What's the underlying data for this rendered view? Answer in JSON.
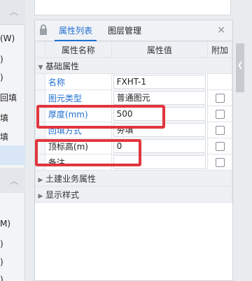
{
  "left_panel": {
    "items": [
      "(W)",
      ")",
      ")",
      "回填",
      "填",
      "填",
      "M)",
      ")",
      ")",
      ")"
    ]
  },
  "panel": {
    "tabs": [
      {
        "label": "属性列表",
        "active": true
      },
      {
        "label": "图层管理",
        "active": false
      }
    ],
    "close_symbol": "×",
    "columns": {
      "name": "属性名称",
      "value": "属性值",
      "add": "附加"
    },
    "groups": [
      {
        "label": "基础属性",
        "expanded": true
      },
      {
        "label": "土建业务属性",
        "expanded": false
      },
      {
        "label": "显示样式",
        "expanded": false
      }
    ],
    "rows": [
      {
        "name": "名称",
        "value": "FXHT-1",
        "has_checkbox": false,
        "link": true
      },
      {
        "name": "图元类型",
        "value": "普通图元",
        "has_checkbox": true,
        "link": true
      },
      {
        "name": "厚度(mm)",
        "value": "500",
        "has_checkbox": true,
        "link": true
      },
      {
        "name": "回填方式",
        "value": "夯填",
        "has_checkbox": true,
        "link": true
      },
      {
        "name": "顶标高(m)",
        "value": "0",
        "has_checkbox": true,
        "link": false
      },
      {
        "name": "备注",
        "value": "",
        "has_checkbox": true,
        "link": false
      }
    ]
  },
  "icons": {
    "collapse": "chevron-up-icon",
    "pin": "pin-icon",
    "close": "close-icon",
    "expand": "triangle-down-icon",
    "collapsed": "triangle-right-icon",
    "side_handle": "chevron-left-icon"
  },
  "colors": {
    "accent": "#1f6fcf",
    "highlight": "#e0363f",
    "header_bg": "#eef0f3"
  }
}
